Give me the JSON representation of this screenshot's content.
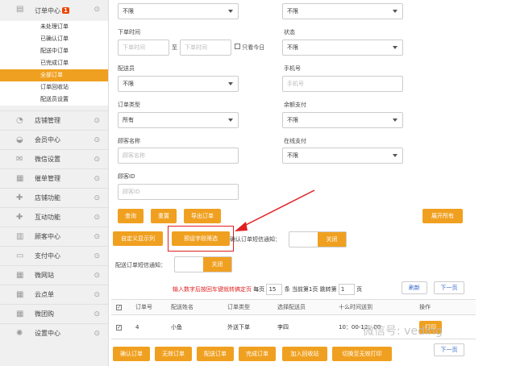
{
  "sidebar": {
    "order_center": {
      "label": "订单中心",
      "badge": "1"
    },
    "sub_items": [
      "未处理订单",
      "已确认订单",
      "配送中订单",
      "已完成订单",
      "全部订单",
      "订单回收站",
      "配送员设置"
    ],
    "groups": [
      "店铺管理",
      "会员中心",
      "微信设置",
      "催单管理",
      "店铺功能",
      "互动功能",
      "顾客中心",
      "支付中心",
      "微网站",
      "云点单",
      "微团购",
      "设置中心"
    ]
  },
  "form": {
    "top_left_select": "不限",
    "top_right_select": "不限",
    "order_time_label": "下单时间",
    "start_time_placeholder": "下单时间",
    "to_label": "至",
    "end_time_placeholder": "下单时间",
    "today_only_label": "只看今日",
    "status_label": "状态",
    "status_value": "不限",
    "courier_label": "配送员",
    "courier_value": "不限",
    "phone_label": "手机号",
    "phone_placeholder": "手机号",
    "order_type_label": "订单类型",
    "order_type_value": "所有",
    "balance_pay_label": "余额支付",
    "balance_pay_value": "不限",
    "customer_name_label": "顾客名称",
    "customer_name_placeholder": "顾客名称",
    "online_pay_label": "在线支付",
    "online_pay_value": "不限",
    "customer_id_label": "顾客ID",
    "customer_id_placeholder": "顾客ID"
  },
  "actions": {
    "search": "查询",
    "reset": "重置",
    "export": "导出订单",
    "expand_all": "展开所有",
    "custom_columns": "自定义显示列",
    "preset_filter": "预设字段筛选",
    "confirm_sms_label": "确认订单短信通知：",
    "confirm_sms_state": "关闭",
    "delivery_sms_label": "配送订单短信通知：",
    "delivery_sms_state": "关闭"
  },
  "pager": {
    "hint": "输入数字后按回车键就转搞定页",
    "per_page_label": "每页",
    "per_page": "15",
    "per_page_unit": "条",
    "current_label": "当前第1页",
    "jump_label": "跳转第",
    "jump_value": "1",
    "jump_unit": "页",
    "refresh": "刷新",
    "next": "下一页",
    "next_bottom": "下一页"
  },
  "table": {
    "headers": [
      "订单号",
      "配送姓名",
      "订单类型",
      "选择配送员",
      "十么时间送到",
      "操作"
    ],
    "rows": [
      {
        "id": "4",
        "name": "小鱼",
        "type": "外送下单",
        "courier": "李四",
        "time": "10：00-12：00",
        "action": "打印"
      }
    ]
  },
  "bottom_buttons": [
    "确认订单",
    "无效订单",
    "配送订单",
    "完成订单",
    "加入回收站",
    "切换至无效打印"
  ],
  "watermark": "微信号: veding",
  "colors": {
    "accent": "#f0a020",
    "highlight": "#e02020"
  }
}
